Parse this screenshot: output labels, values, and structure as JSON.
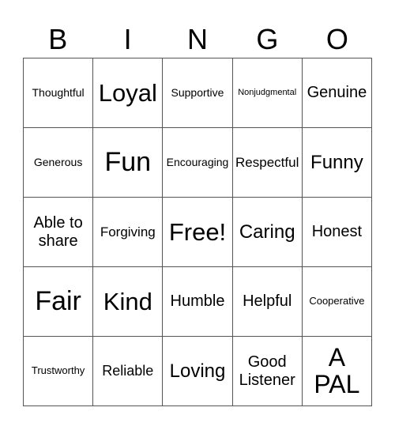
{
  "header": {
    "letters": [
      "B",
      "I",
      "N",
      "G",
      "O"
    ]
  },
  "cells": [
    [
      "Thoughtful",
      "Loyal",
      "Supportive",
      "Nonjudgmental",
      "Genuine"
    ],
    [
      "Generous",
      "Fun",
      "Encouraging",
      "Respectful",
      "Funny"
    ],
    [
      "Able to share",
      "Forgiving",
      "Free!",
      "Caring",
      "Honest"
    ],
    [
      "Fair",
      "Kind",
      "Humble",
      "Helpful",
      "Cooperative"
    ],
    [
      "Trustworthy",
      "Reliable",
      "Loving",
      "Good Listener",
      "A PAL"
    ]
  ]
}
